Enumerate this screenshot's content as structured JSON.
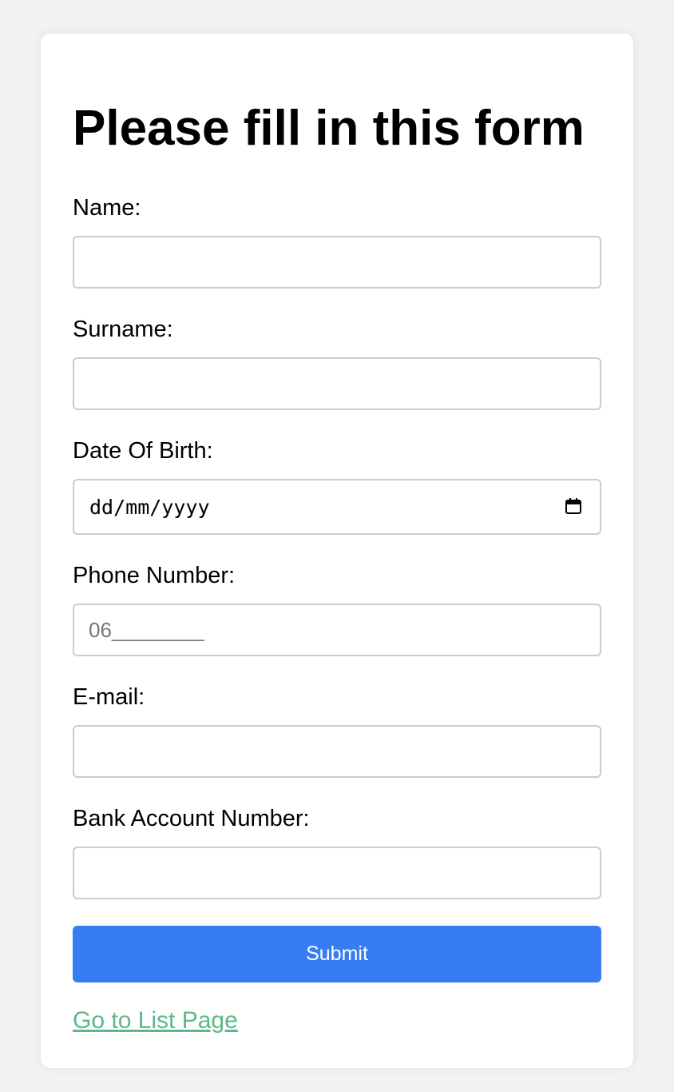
{
  "form": {
    "title": "Please fill in this form",
    "fields": [
      {
        "label": "Name:",
        "value": "",
        "placeholder": ""
      },
      {
        "label": "Surname:",
        "value": "",
        "placeholder": ""
      },
      {
        "label": "Date Of Birth:",
        "value": "",
        "placeholder": "dd/mm/yyyy"
      },
      {
        "label": "Phone Number:",
        "value": "",
        "placeholder": "06________"
      },
      {
        "label": "E-mail:",
        "value": "",
        "placeholder": ""
      },
      {
        "label": "Bank Account Number:",
        "value": "",
        "placeholder": ""
      }
    ],
    "submit_label": "Submit",
    "list_link_label": "Go to List Page"
  },
  "colors": {
    "background": "#f2f2f2",
    "card": "#ffffff",
    "submit_button": "#377cf4",
    "link": "#5cb88a",
    "input_border": "#cccccc"
  },
  "icons": {
    "date_picker": "calendar-icon"
  }
}
